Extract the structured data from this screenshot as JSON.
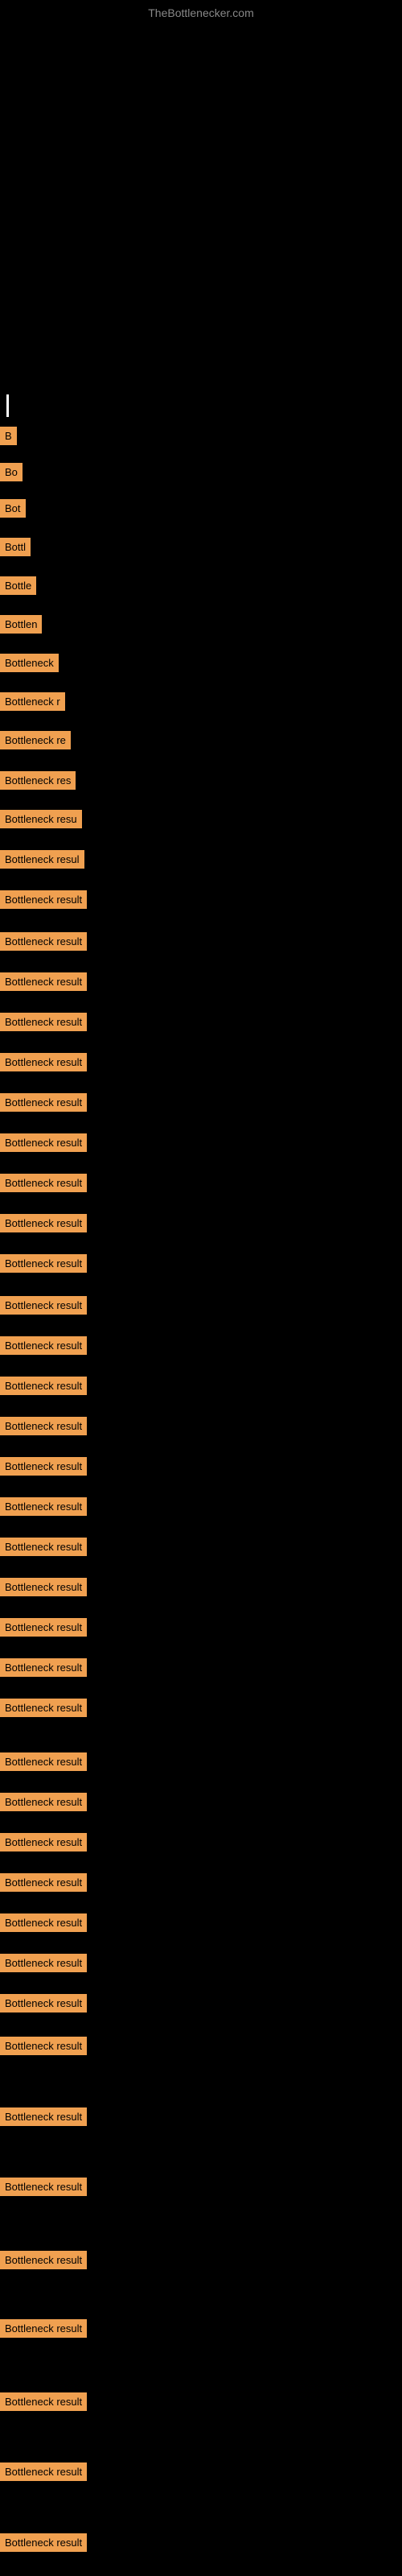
{
  "site": {
    "title": "TheBottlenecker.com"
  },
  "labels": {
    "b": "B",
    "bo": "Bo",
    "bot": "Bot",
    "bottl": "Bottl",
    "bottle": "Bottle",
    "bottlen": "Bottlen",
    "bottleneck": "Bottleneck",
    "bottleneck_r": "Bottleneck r",
    "bottleneck_re": "Bottleneck re",
    "bottleneck_res": "Bottleneck res",
    "bottleneck_resu": "Bottleneck resu",
    "bottleneck_resul": "Bottleneck resul",
    "bottleneck_result": "Bottleneck result"
  }
}
